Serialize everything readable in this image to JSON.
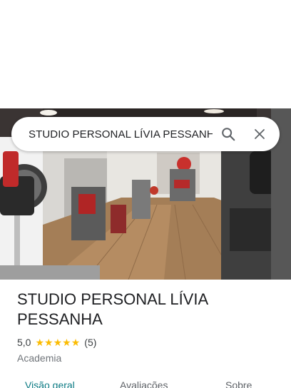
{
  "search": {
    "query": "STUDIO PERSONAL LÍVIA PESSANHA"
  },
  "place": {
    "name": "STUDIO PERSONAL LÍVIA PESSANHA",
    "rating": "5,0",
    "stars": 5,
    "review_count": "(5)",
    "category": "Academia"
  },
  "tabs": [
    {
      "label": "Visão geral",
      "active": true
    },
    {
      "label": "Avaliações",
      "active": false
    },
    {
      "label": "Sobre",
      "active": false
    }
  ],
  "icons": {
    "search": "search-icon",
    "close": "close-icon",
    "star": "star-icon"
  },
  "colors": {
    "star": "#fbbc04",
    "active_tab": "#0b7a83",
    "text_primary": "#202124",
    "text_secondary": "#70757a"
  }
}
